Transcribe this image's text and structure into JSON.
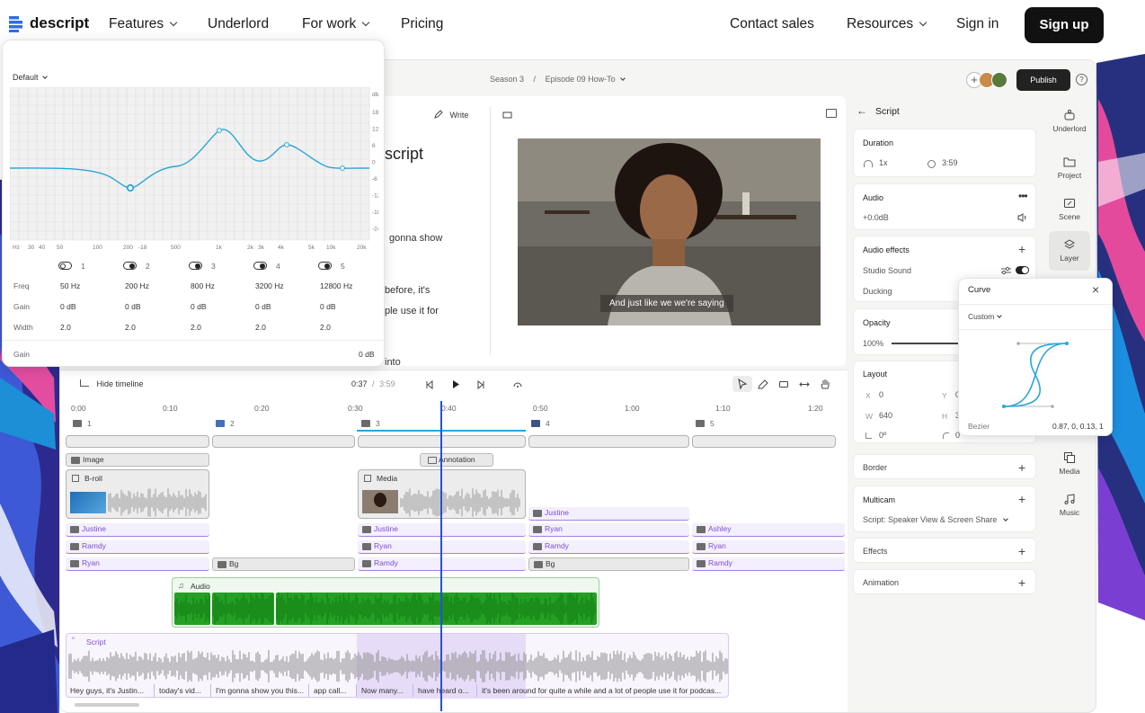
{
  "nav": {
    "brand": "descript",
    "features": "Features",
    "underlord": "Underlord",
    "for_work": "For work",
    "pricing": "Pricing",
    "contact_sales": "Contact sales",
    "resources": "Resources",
    "sign_in": "Sign in",
    "sign_up": "Sign up"
  },
  "app_header": {
    "season": "Season 3",
    "separator": "/",
    "episode": "Episode 09 How-To",
    "publish": "Publish",
    "help": "?"
  },
  "editor": {
    "write": "Write",
    "heading_fragment": "script",
    "lines": [
      "gonna show",
      "before, it's",
      "ple use it for",
      "into"
    ],
    "caption": "And just like we we're saying"
  },
  "script_panel": {
    "back": "←",
    "title": "Script",
    "duration_label": "Duration",
    "speed": "1x",
    "duration": "3:59",
    "audio_label": "Audio",
    "audio_gain": "+0.0dB",
    "audio_effects_label": "Audio effects",
    "studio_sound": "Studio Sound",
    "ducking": "Ducking",
    "opacity_label": "Opacity",
    "opacity_value": "100%",
    "layout_label": "Layout",
    "x_label": "X",
    "x_value": "0",
    "y_label": "Y",
    "y_value": "0",
    "w_label": "W",
    "w_value": "640",
    "h_label": "H",
    "h_value": "3",
    "rotation": "0º",
    "corner": "0",
    "border_label": "Border",
    "multicam_label": "Multicam",
    "multicam_value": "Script: Speaker View & Screen Share",
    "effects_label": "Effects",
    "animation_label": "Animation"
  },
  "sidebar": [
    {
      "label": "Underlord",
      "icon": "underlord-icon"
    },
    {
      "label": "Project",
      "icon": "folder-icon"
    },
    {
      "label": "Scene",
      "icon": "scene-icon"
    },
    {
      "label": "Layer",
      "icon": "layers-icon"
    },
    {
      "label": "Media",
      "icon": "media-icon"
    },
    {
      "label": "Music",
      "icon": "music-icon"
    }
  ],
  "curve_popup": {
    "title": "Curve",
    "preset": "Custom",
    "type_label": "Bezier",
    "values": "0.87, 0, 0.13, 1"
  },
  "eq": {
    "preset": "Default",
    "db_unit": "db",
    "db_ticks": [
      "18",
      "12",
      "6",
      "0",
      "-6",
      "-12",
      "-18",
      "-24"
    ],
    "freq_ticks": [
      "Hz",
      "30",
      "40",
      "50",
      "100",
      "200",
      "-18",
      "500",
      "1k",
      "2k",
      "3k",
      "4k",
      "5k",
      "10k",
      "20k"
    ],
    "bands": [
      {
        "num": "1",
        "freq": "50 Hz",
        "gain": "0 dB",
        "width": "2.0",
        "on": false
      },
      {
        "num": "2",
        "freq": "200 Hz",
        "gain": "0 dB",
        "width": "2.0",
        "on": true
      },
      {
        "num": "3",
        "freq": "800 Hz",
        "gain": "0 dB",
        "width": "2.0",
        "on": true
      },
      {
        "num": "4",
        "freq": "3200 Hz",
        "gain": "0 dB",
        "width": "2.0",
        "on": true
      },
      {
        "num": "5",
        "freq": "12800 Hz",
        "gain": "0 dB",
        "width": "2.0",
        "on": true
      }
    ],
    "row_freq": "Freq",
    "row_gain": "Gain",
    "row_width": "Width",
    "gain_label": "Gain",
    "gain_value": "0 dB"
  },
  "timeline": {
    "hide": "Hide timeline",
    "current": "0:37",
    "slash": "/",
    "total": "3:59",
    "ruler": [
      "0:00",
      "0:10",
      "0:20",
      "0:30",
      "0:40",
      "0:50",
      "1:00",
      "1:10",
      "1:20"
    ],
    "scenes": [
      "1",
      "2",
      "3",
      "4",
      "5"
    ],
    "image_label": "Image",
    "annotation_label": "Annotation",
    "broll_label": "B-roll",
    "media_label": "Media",
    "audio_label": "Audio",
    "script_label": "Script",
    "tracks_col1": [
      "Justine",
      "Ramdy",
      "Ryan"
    ],
    "bg1": "Bg",
    "tracks_col3": [
      "Justine",
      "Ryan",
      "Ramdy"
    ],
    "tracks_col4": [
      "Justine",
      "Ryan",
      "Ramdy"
    ],
    "bg4": "Bg",
    "tracks_col5": [
      "Ashley",
      "Ryan",
      "Ramdy"
    ],
    "words": [
      "Hey guys, it's Justin...",
      "today's vid...",
      "I'm gonna show you this...",
      "app call...",
      "Now many...",
      "have heard o...",
      "it's been around for quite a while and a lot of people use it for podcas..."
    ]
  },
  "colors": {
    "accent": "#2aa6d6",
    "purple": "#8a5ce0",
    "green": "#2fa52f",
    "playhead": "#2551d8"
  }
}
